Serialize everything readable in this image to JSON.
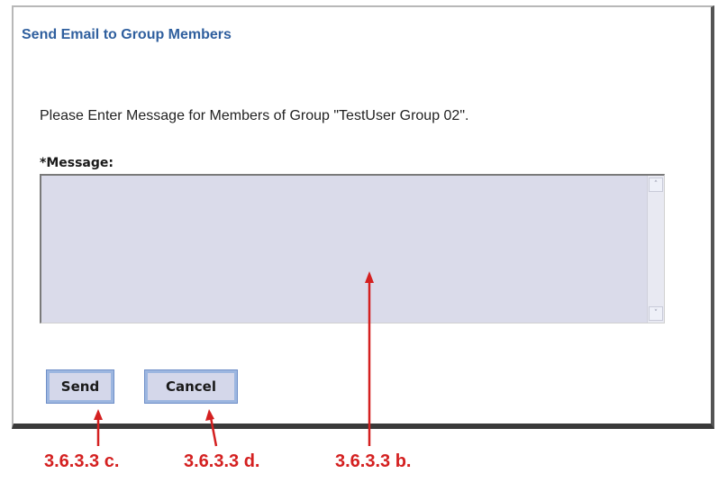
{
  "dialog": {
    "title": "Send Email to Group Members",
    "instruction": "Please Enter Message for Members of Group \"TestUser Group 02\".",
    "message_label": "*Message:",
    "message_value": "",
    "send_label": "Send",
    "cancel_label": "Cancel"
  },
  "scrollbar": {
    "up_arrow": "˄",
    "down_arrow": "˅"
  },
  "annotations": {
    "send": "3.6.3.3 c.",
    "cancel": "3.6.3.3 d.",
    "message": "3.6.3.3 b."
  },
  "colors": {
    "title": "#2f5f9e",
    "textarea_background": "#dadbea",
    "button_background": "#d4d7ea",
    "annotation_red": "#d42020"
  }
}
